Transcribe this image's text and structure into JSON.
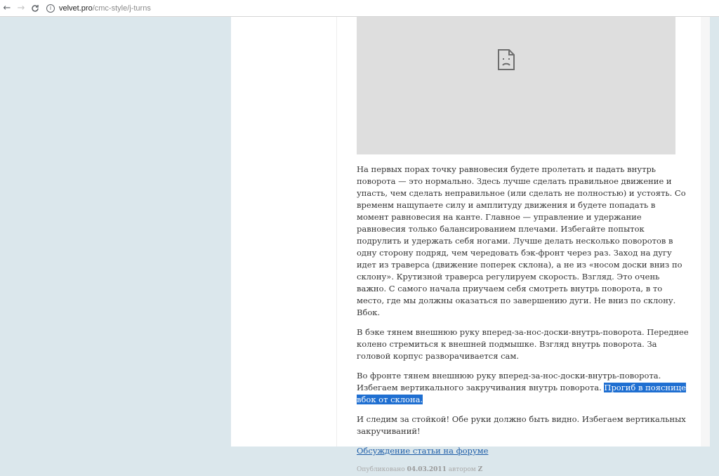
{
  "browser": {
    "back_icon": "←",
    "forward_icon": "→",
    "reload_icon": "C",
    "info_icon": "i",
    "url_domain": "velvet.pro",
    "url_path": "/cmc-style/j-turns"
  },
  "article": {
    "video_icon": "broken-file-icon",
    "p1": "На первых порах точку равновесия будете пролетать и падать внутрь поворота — это нормально. Здесь лучше сделать правильное движение и упасть, чем сделать неправильное (или сделать не полностью) и устоять. Со временм нащупаете силу и амплитуду движения и будете попадать в момент равновесия на канте. Главное — управление и удержание равновесия только балансированием плечами. Избегайте попыток подрулить и удержать себя ногами. Лучше делать несколько поворотов в одну сторону подряд, чем чередовать бэк-фронт через раз. Заход на дугу идет из траверса (движение поперек склона), а не из «носом доски вниз по склону». Крутизной траверса регулируем скорость. Взгляд. Это очень важно. С самого начала приучаем себя смотреть внутрь поворота, в то место, где мы должны оказаться по завершению дуги. Не вниз по склону. Вбок.",
    "p2": "В бэке тянем внешнюю руку вперед-за-нос-доски-внутрь-поворота. Переднее колено стремиться к внешней подмышке. Взгляд внутрь поворота. За головой корпус разворачивается сам.",
    "p3_text": "Во фронте тянем внешнюю руку вперед-за-нос-доски-внутрь-поворота. Избегаем вертикального закручивания внутрь поворота. ",
    "p3_highlight": "Прогиб в пояснице вбок от склона.",
    "p4": "И следим за стойкой! Обе руки должно быть видно. Избегаем вертикальных закручиваний!",
    "forum_link": "Обсуждение статьи на форуме",
    "meta_prefix": "Опубликовано ",
    "meta_date": "04.03.2011",
    "meta_mid": " автором ",
    "meta_author": "Z"
  },
  "colors": {
    "background": "#dbe7ec",
    "highlight": "#1f6fd1",
    "link": "#1f5ea8"
  }
}
